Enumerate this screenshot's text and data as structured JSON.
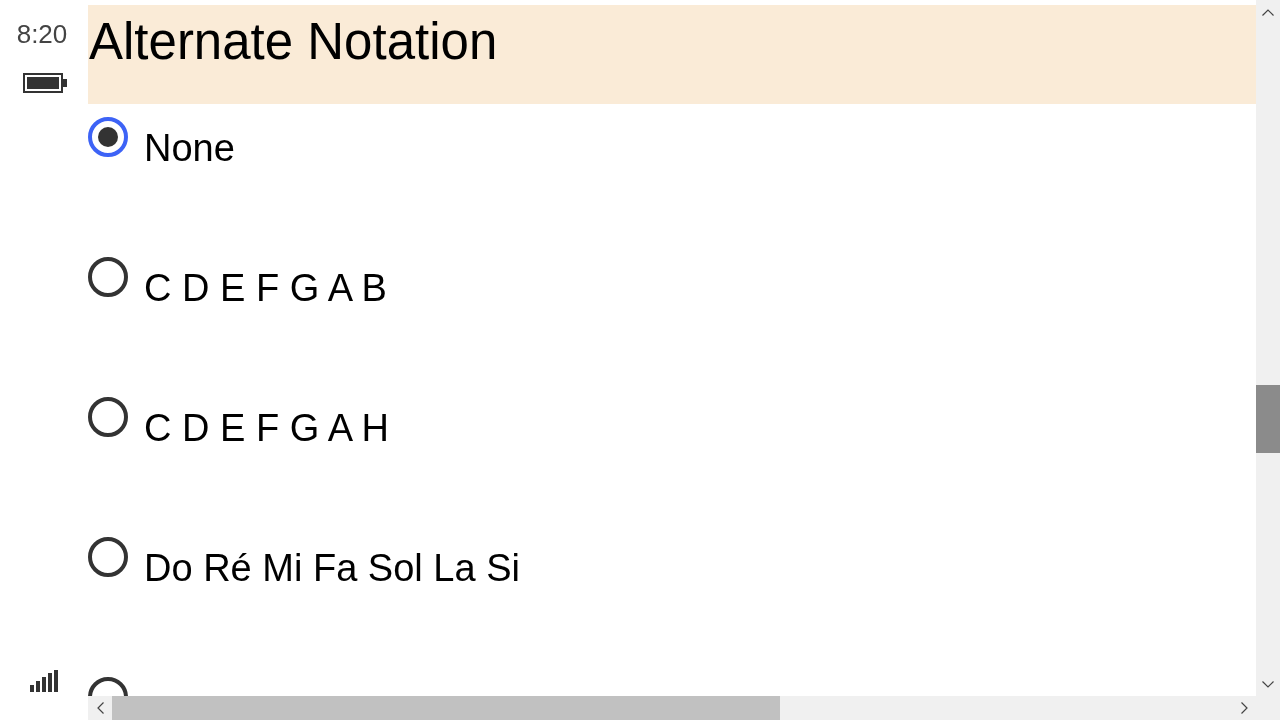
{
  "status_bar": {
    "time": "8:20"
  },
  "section": {
    "title": "Alternate Notation"
  },
  "options": [
    {
      "label": "None",
      "selected": true
    },
    {
      "label": "C D E F G A B",
      "selected": false
    },
    {
      "label": "C D E F G A H",
      "selected": false
    },
    {
      "label": "Do Ré Mi Fa Sol La Si",
      "selected": false
    },
    {
      "selected": false
    }
  ]
}
